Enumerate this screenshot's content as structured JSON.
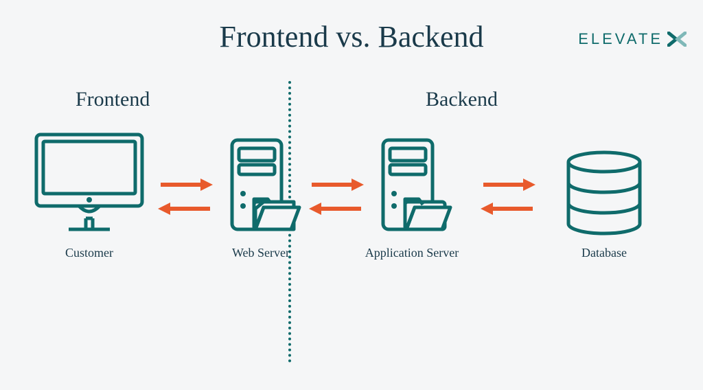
{
  "brand": {
    "name": "ELEVATE"
  },
  "title": "Frontend vs. Backend",
  "sections": {
    "frontend": "Frontend",
    "backend": "Backend"
  },
  "nodes": {
    "customer": "Customer",
    "web_server": "Web Server",
    "app_server": "Application Server",
    "database": "Database"
  },
  "colors": {
    "teal": "#0f6b6b",
    "orange": "#e85a2c",
    "text": "#1a3a4a"
  }
}
